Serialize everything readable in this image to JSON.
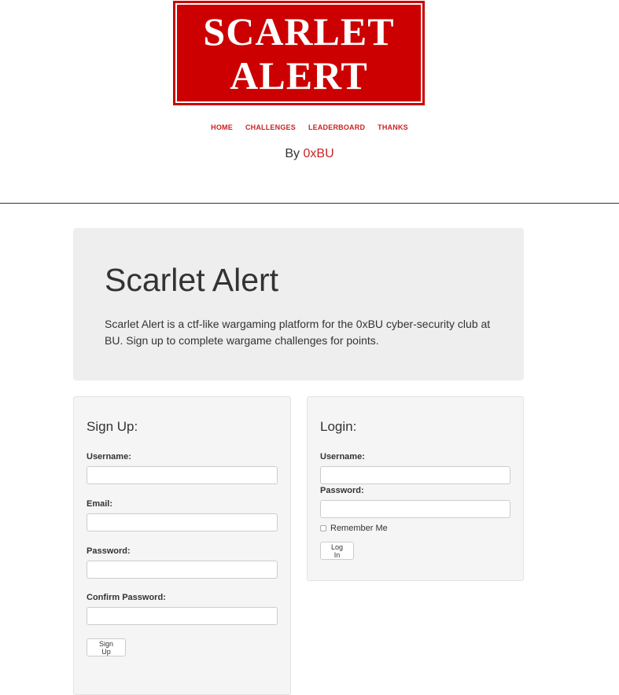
{
  "logo": {
    "line1": "SCARLET",
    "line2": "ALERT",
    "color": "#cc0000"
  },
  "nav": {
    "items": [
      {
        "label": "HOME"
      },
      {
        "label": "CHALLENGES"
      },
      {
        "label": "LEADERBOARD"
      },
      {
        "label": "THANKS"
      }
    ],
    "link_color": "#cc2222"
  },
  "byline": {
    "prefix": "By ",
    "link": "0xBU"
  },
  "jumbotron": {
    "title": "Scarlet Alert",
    "description": "Scarlet Alert is a ctf-like wargaming platform for the 0xBU cyber-security club at BU. Sign up to complete wargame challenges for points."
  },
  "signup": {
    "heading": "Sign Up:",
    "username_label": "Username:",
    "username_value": "",
    "email_label": "Email:",
    "email_value": "",
    "password_label": "Password:",
    "password_value": "",
    "confirm_label": "Confirm Password:",
    "confirm_value": "",
    "button": "Sign Up"
  },
  "login": {
    "heading": "Login:",
    "username_label": "Username:",
    "username_value": "",
    "password_label": "Password:",
    "password_value": "",
    "remember_label": "Remember Me",
    "remember_checked": false,
    "button": "Log In"
  }
}
